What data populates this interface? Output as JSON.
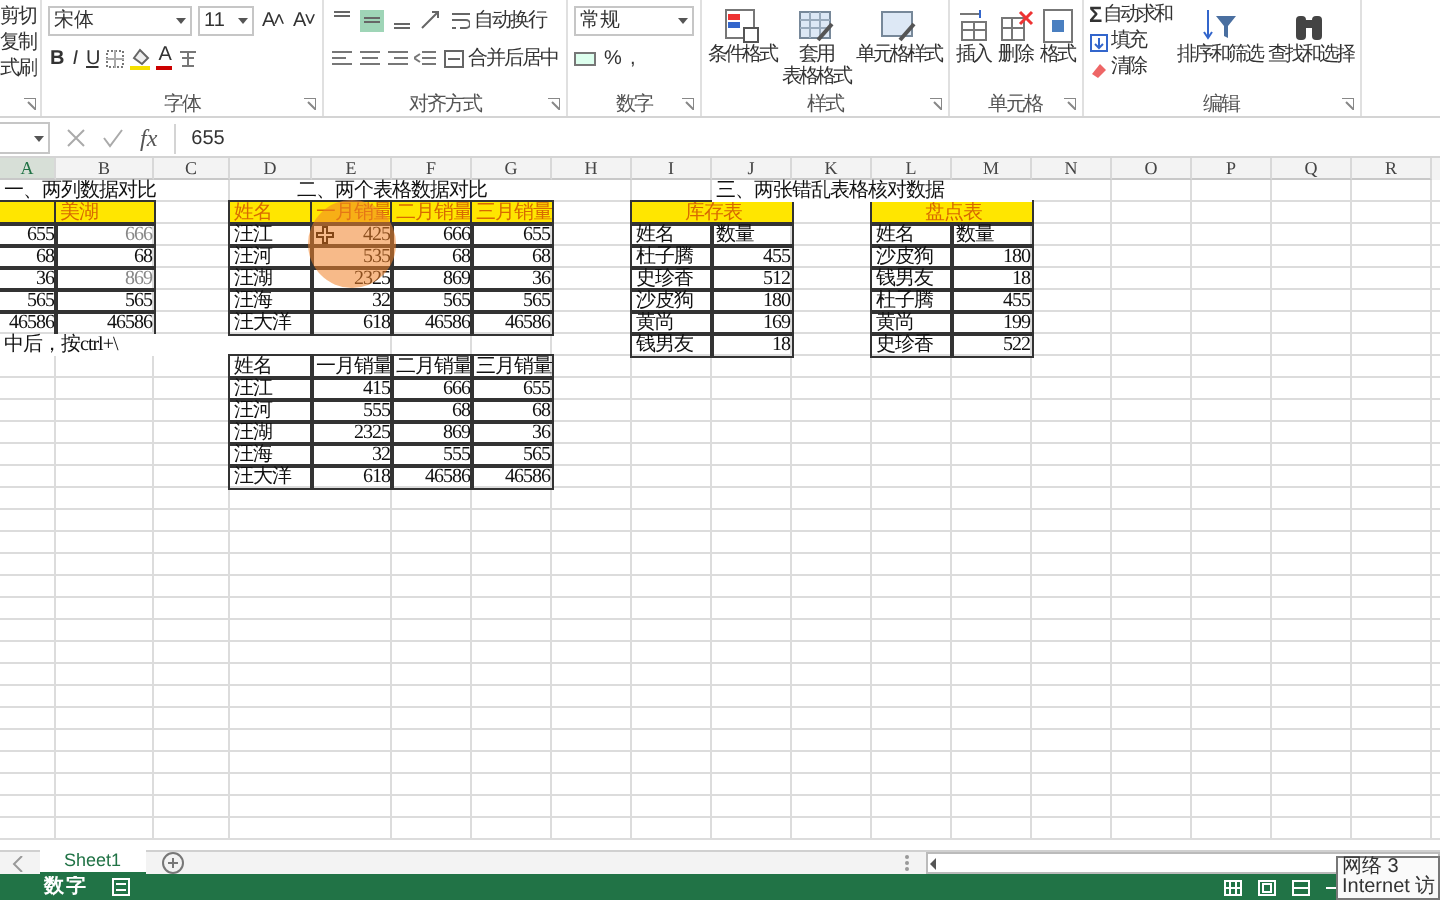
{
  "ribbon": {
    "clipboard": {
      "items": [
        "剪切",
        "复制",
        "式刷"
      ]
    },
    "font": {
      "name": "宋体",
      "size": "11",
      "grow_shrink": [
        "A˄",
        "A˅"
      ],
      "format_buttons": [
        "B",
        "I",
        "U"
      ],
      "font_color": "A",
      "label": "字体"
    },
    "alignment": {
      "valign_buttons": [
        {
          "selected": false
        },
        {
          "selected": true
        },
        {
          "selected": false
        }
      ],
      "wrap": "自动换行",
      "merge": "合并后居中",
      "label": "对齐方式"
    },
    "number": {
      "format": "常规",
      "buttons": [
        "%",
        ","
      ],
      "label": "数字"
    },
    "styles": {
      "buttons": [
        [
          "条件格式"
        ],
        [
          "套用",
          "表格格式"
        ],
        [
          "单元格样式"
        ]
      ],
      "label": "样式"
    },
    "cells": {
      "buttons": [
        "插入",
        "删除",
        "格式"
      ],
      "label": "单元格"
    },
    "editing": {
      "sum_symbol": "Σ",
      "items": [
        "自动求和",
        "填充",
        "清除"
      ],
      "buttons": [
        "排序和筛选",
        "查找和选择"
      ],
      "label": "编辑"
    }
  },
  "formula_bar": {
    "fx": "fx",
    "value": "655"
  },
  "columns": [
    {
      "label": "A",
      "selected": true
    },
    {
      "label": "B",
      "selected": false
    },
    {
      "label": "C",
      "selected": false
    },
    {
      "label": "D",
      "selected": false
    },
    {
      "label": "E",
      "selected": false
    },
    {
      "label": "F",
      "selected": false
    },
    {
      "label": "G",
      "selected": false
    },
    {
      "label": "H",
      "selected": false
    },
    {
      "label": "I",
      "selected": false
    },
    {
      "label": "J",
      "selected": false
    },
    {
      "label": "K",
      "selected": false
    },
    {
      "label": "L",
      "selected": false
    },
    {
      "label": "M",
      "selected": false
    },
    {
      "label": "N",
      "selected": false
    },
    {
      "label": "O",
      "selected": false
    },
    {
      "label": "P",
      "selected": false
    },
    {
      "label": "Q",
      "selected": false
    },
    {
      "label": "R",
      "selected": false
    }
  ],
  "sheet": {
    "tables": [
      {
        "title": "一、两列数据对比",
        "header_highlighted": true,
        "header": [
          "美湖"
        ],
        "rows": [
          [
            {
              "text": "655",
              "highlighted": false
            },
            {
              "text": "666",
              "highlighted": true
            }
          ],
          [
            {
              "text": "68",
              "highlighted": false
            },
            {
              "text": "68",
              "highlighted": false
            }
          ],
          [
            {
              "text": "36",
              "highlighted": false
            },
            {
              "text": "869",
              "highlighted": true
            }
          ],
          [
            {
              "text": "565",
              "highlighted": false
            },
            {
              "text": "565",
              "highlighted": false
            }
          ],
          [
            {
              "text": "46586",
              "highlighted": false
            },
            {
              "text": "46586",
              "highlighted": false
            }
          ]
        ],
        "note": "中后，按ctrl+\\"
      },
      {
        "title": "二、两个表格数据对比",
        "header_highlighted": true,
        "header": [
          "姓名",
          "一月销量",
          "二月销量",
          "三月销量"
        ],
        "rows": [
          [
            {
              "text": "汪江",
              "clicked": false
            },
            {
              "text": "425",
              "clicked": true
            },
            {
              "text": "666",
              "clicked": false
            },
            {
              "text": "655",
              "clicked": false
            }
          ],
          [
            {
              "text": "汪河",
              "clicked": false
            },
            {
              "text": "535",
              "clicked": false
            },
            {
              "text": "68",
              "clicked": false
            },
            {
              "text": "68",
              "clicked": false
            }
          ],
          [
            {
              "text": "汪湖",
              "clicked": false
            },
            {
              "text": "2325",
              "clicked": false
            },
            {
              "text": "869",
              "clicked": false
            },
            {
              "text": "36",
              "clicked": false
            }
          ],
          [
            {
              "text": "汪海",
              "clicked": false
            },
            {
              "text": "32",
              "clicked": false
            },
            {
              "text": "565",
              "clicked": false
            },
            {
              "text": "565",
              "clicked": false
            }
          ],
          [
            {
              "text": "汪大洋",
              "clicked": false
            },
            {
              "text": "618",
              "clicked": false
            },
            {
              "text": "46586",
              "clicked": false
            },
            {
              "text": "46586",
              "clicked": false
            }
          ]
        ]
      },
      {
        "header_highlighted": false,
        "header": [
          "姓名",
          "一月销量",
          "二月销量",
          "三月销量"
        ],
        "rows": [
          [
            "汪江",
            "415",
            "666",
            "655"
          ],
          [
            "汪河",
            "555",
            "68",
            "68"
          ],
          [
            "汪湖",
            "2325",
            "869",
            "36"
          ],
          [
            "汪海",
            "32",
            "555",
            "565"
          ],
          [
            "汪大洋",
            "618",
            "46586",
            "46586"
          ]
        ]
      },
      {
        "caption": "库存表",
        "header_highlighted": false,
        "header": [
          "姓名",
          "数量"
        ],
        "rows": [
          [
            "杜子腾",
            "455"
          ],
          [
            "史珍香",
            "512"
          ],
          [
            "沙皮狗",
            "180"
          ],
          [
            "黄尚",
            "169"
          ],
          [
            "钱男友",
            "18"
          ]
        ]
      },
      {
        "caption": "盘点表",
        "header_highlighted": false,
        "header": [
          "姓名",
          "数量"
        ],
        "rows": [
          [
            "沙皮狗",
            "180"
          ],
          [
            "钱男友",
            "18"
          ],
          [
            "杜子腾",
            "455"
          ],
          [
            "黄尚",
            "199"
          ],
          [
            "史珍香",
            "522"
          ]
        ]
      }
    ],
    "section_title": "三、两张错乱表格核对数据"
  },
  "sheet_tabs": [
    {
      "label": "Sheet1",
      "selected": true
    }
  ],
  "status_bar": {
    "mode": "数字"
  },
  "tooltip": {
    "lines": [
      "网络  3",
      "Internet 访"
    ]
  }
}
